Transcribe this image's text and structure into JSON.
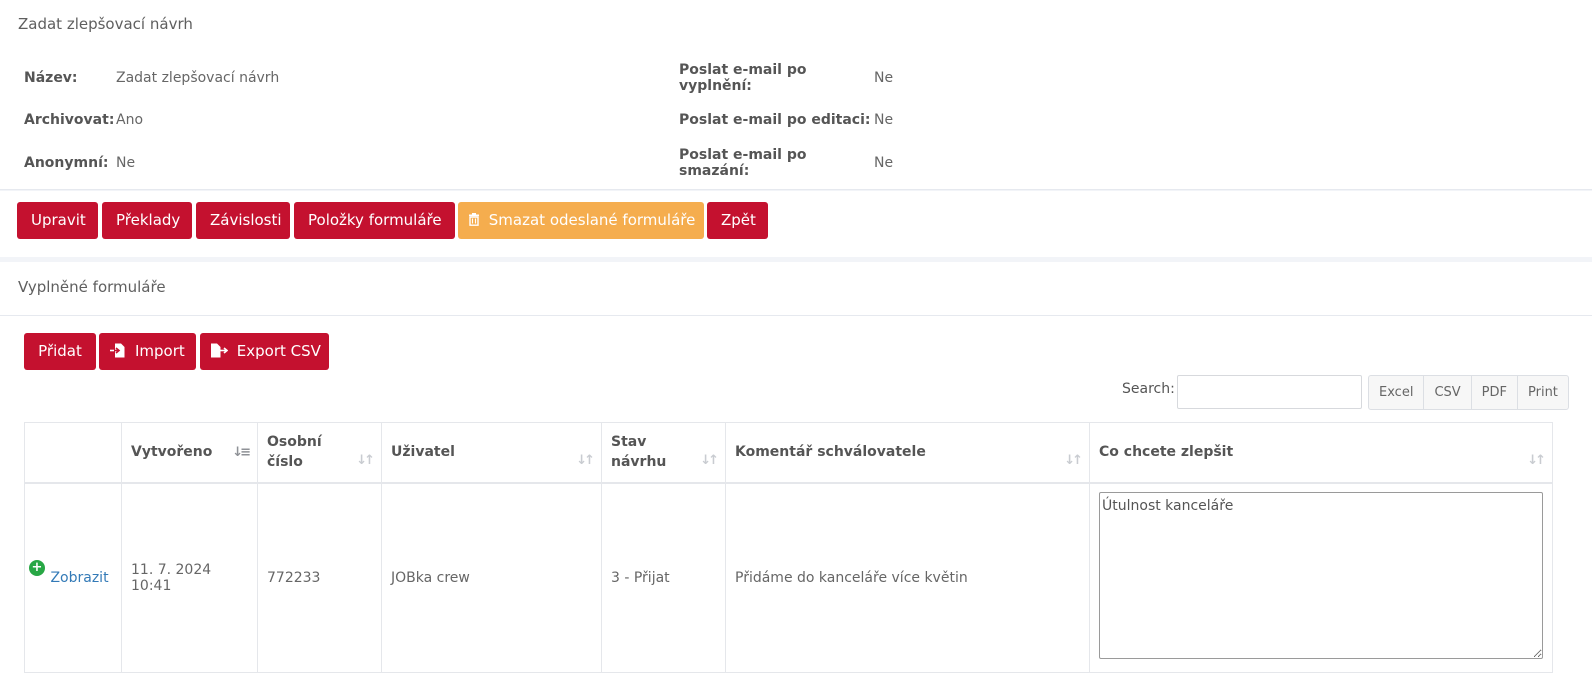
{
  "detail": {
    "title": "Zadat zlepšovací návrh",
    "fields": {
      "name_label": "Název:",
      "name_value": "Zadat zlepšovací návrh",
      "archive_label": "Archivovat:",
      "archive_value": "Ano",
      "anon_label": "Anonymní:",
      "anon_value": "Ne",
      "mail_fill_label": "Poslat e-mail po vyplnění:",
      "mail_fill_value": "Ne",
      "mail_edit_label": "Poslat e-mail po editaci:",
      "mail_edit_value": "Ne",
      "mail_delete_label": "Poslat e-mail po smazání:",
      "mail_delete_value": "Ne"
    }
  },
  "actions": {
    "edit": "Upravit",
    "translations": "Překlady",
    "dependencies": "Závislosti",
    "form_items": "Položky formuláře",
    "delete_submitted": "Smazat odeslané formuláře",
    "back": "Zpět"
  },
  "forms": {
    "title": "Vyplněné formuláře",
    "add": "Přidat",
    "import": "Import",
    "export_csv": "Export CSV",
    "search_label": "Search:",
    "search_value": "",
    "export_buttons": [
      "Excel",
      "CSV",
      "PDF",
      "Print"
    ],
    "columns": [
      "Vytvořeno",
      "Osobní číslo",
      "Uživatel",
      "Stav návrhu",
      "Komentář schválovatele",
      "Co chcete zlepšit"
    ],
    "rows": [
      {
        "action": "Zobrazit",
        "created": "11. 7. 2024 10:41",
        "personal_number": "772233",
        "user": "JOBka crew",
        "status": "3 - Přijat",
        "comment": "Přidáme do kanceláře více květin",
        "improve": "Útulnost kanceláře"
      }
    ]
  },
  "colors": {
    "primary": "#c4112f",
    "warning": "#f5ad4e",
    "link": "#337ab7",
    "expand": "#28a745"
  }
}
